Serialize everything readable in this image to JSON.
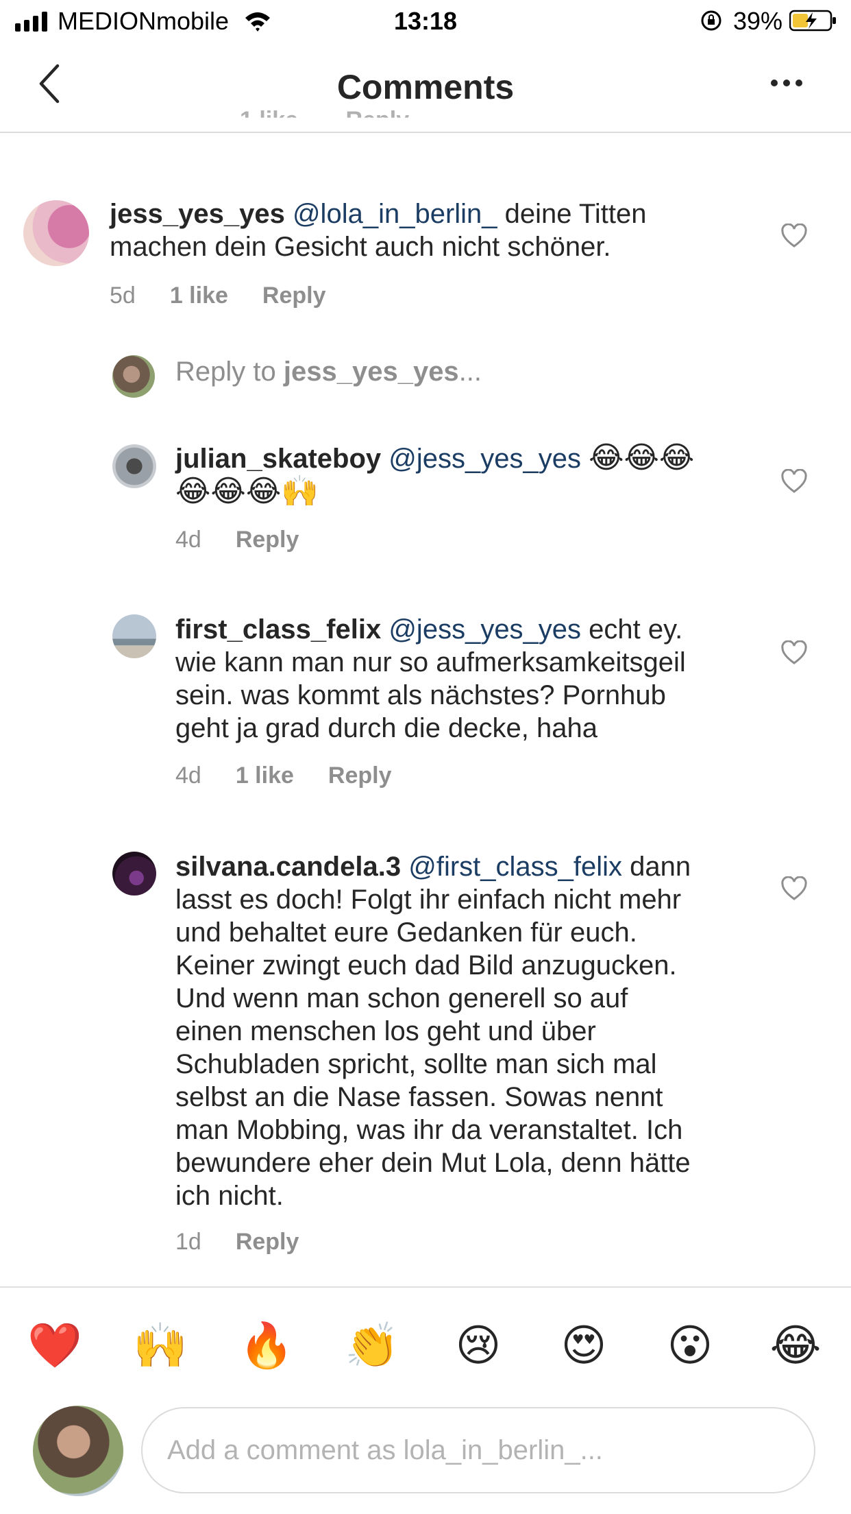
{
  "status_bar": {
    "carrier": "MEDIONmobile",
    "time": "13:18",
    "battery_percent": "39%"
  },
  "nav": {
    "title": "Comments"
  },
  "partial_row": {
    "likes": "1 like",
    "reply": "Reply"
  },
  "comments": [
    {
      "username": "jess_yes_yes",
      "mention": "@lola_in_berlin_",
      "text_line1": " deine Titten",
      "text_line2": "machen dein Gesicht auch nicht schöner.",
      "time": "5d",
      "likes": "1 like",
      "reply": "Reply"
    },
    {
      "username": "julian_skateboy",
      "mention": "@jess_yes_yes",
      "emoji_line1": "😂😂😂",
      "emoji_line2": "😂😂😂🙌",
      "time": "4d",
      "reply": "Reply"
    },
    {
      "username": "first_class_felix",
      "mention": "@jess_yes_yes",
      "text_line1": " echt ey.",
      "text_line2": "wie kann man nur so aufmerksamkeitsgeil",
      "text_line3": "sein. was kommt als nächstes? Pornhub",
      "text_line4": "geht ja grad durch die decke, haha",
      "time": "4d",
      "likes": "1 like",
      "reply": "Reply"
    },
    {
      "username": "silvana.candela.3",
      "mention": "@first_class_felix",
      "text_line1": " dann",
      "lines": [
        "lasst es doch! Folgt ihr einfach nicht mehr",
        "und behaltet eure Gedanken für euch.",
        "Keiner zwingt euch dad Bild anzugucken.",
        "Und wenn man schon generell so auf",
        "einen menschen los geht und über",
        "Schubladen spricht, sollte man sich mal",
        "selbst an die Nase fassen. Sowas nennt",
        "man Mobbing, was ihr da veranstaltet. Ich",
        "bewundere eher dein Mut Lola, denn hätte",
        "ich nicht."
      ],
      "time": "1d",
      "reply": "Reply"
    }
  ],
  "reply_to": {
    "prefix": "Reply to ",
    "username": "jess_yes_yes",
    "suffix": "..."
  },
  "emoji_bar": [
    "❤️",
    "🙌",
    "🔥",
    "👏",
    "😢",
    "😍",
    "😮",
    "😂"
  ],
  "input": {
    "placeholder": "Add a comment as lola_in_berlin_..."
  }
}
